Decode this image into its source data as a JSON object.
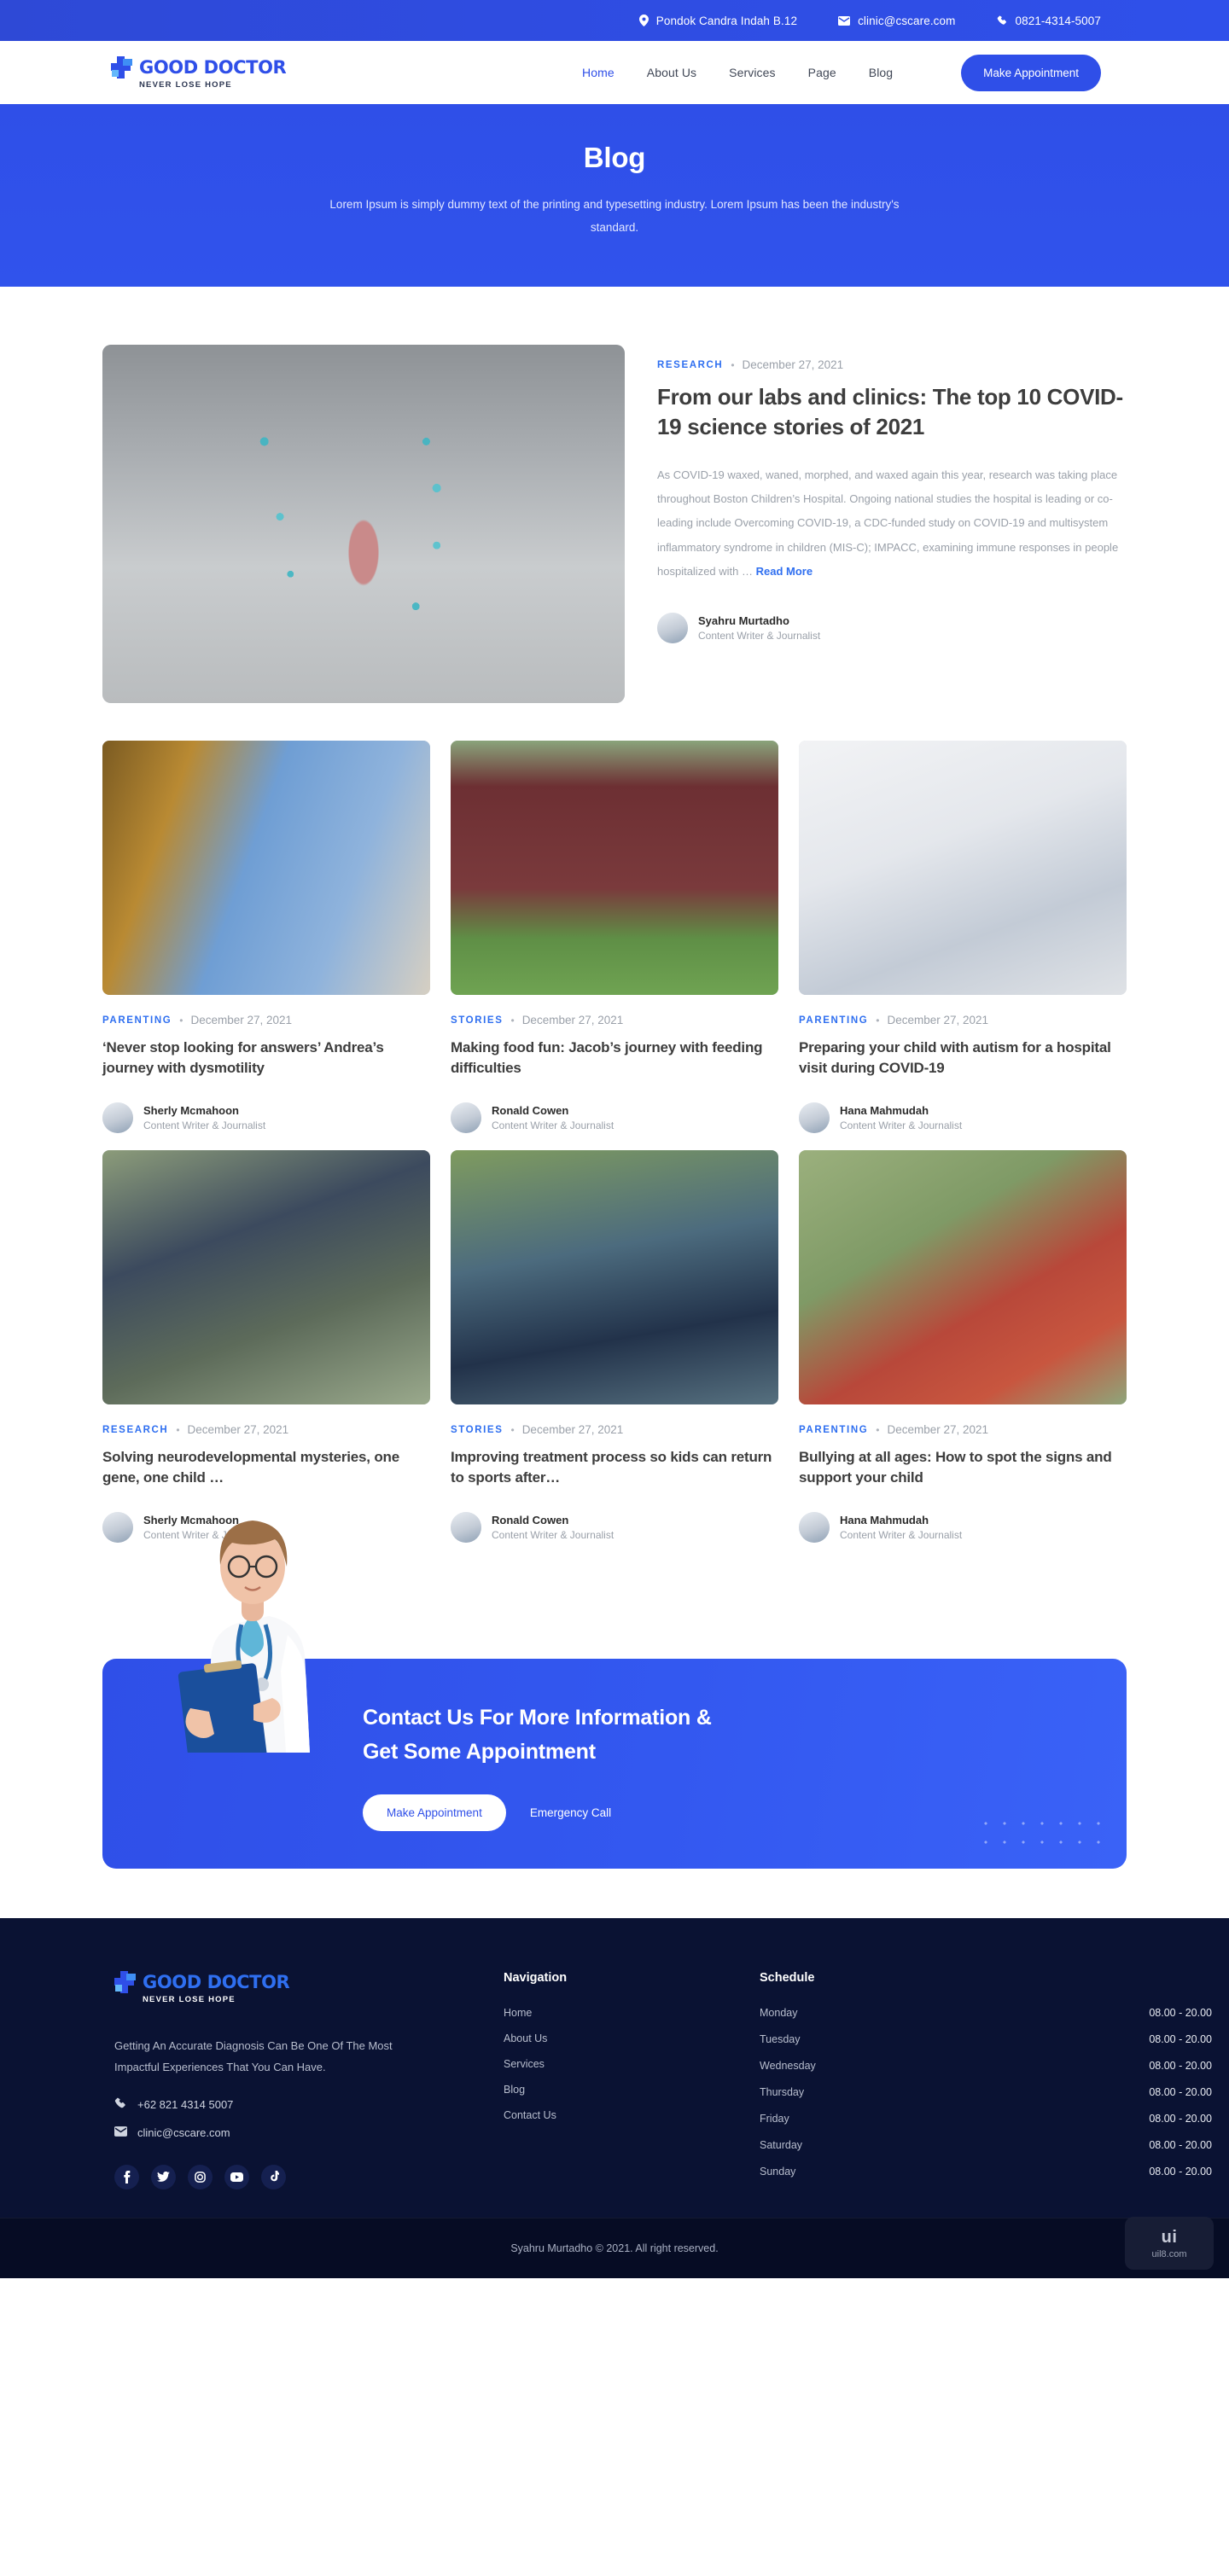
{
  "topbar": {
    "address": "Pondok Candra Indah B.12",
    "email": "clinic@cscare.com",
    "phone": "0821-4314-5007"
  },
  "brand": {
    "name": "GOOD DOCTOR",
    "tagline": "NEVER LOSE HOPE",
    "accent": "#2f4fe8"
  },
  "nav": {
    "items": [
      {
        "label": "Home",
        "active": true
      },
      {
        "label": "About Us",
        "active": false
      },
      {
        "label": "Services",
        "active": false
      },
      {
        "label": "Page",
        "active": false
      },
      {
        "label": "Blog",
        "active": false
      }
    ],
    "cta_label": "Make Appointment"
  },
  "hero": {
    "title": "Blog",
    "subtitle": "Lorem Ipsum is simply dummy text of the printing and typesetting industry. Lorem Ipsum has been the industry's standard."
  },
  "featured": {
    "category": "RESEARCH",
    "separator": "•",
    "date": "December 27, 2021",
    "title": "From our labs and clinics: The top 10 COVID-19 science stories of 2021",
    "excerpt": "As COVID-19 waxed, waned, morphed, and waxed again this year, research was taking place throughout Boston Children’s Hospital. Ongoing national studies the hospital is leading or co-leading include Overcoming COVID-19, a CDC-funded study on COVID-19 and multisystem inflammatory syndrome in children (MIS-C); IMPACC, examining immune responses in people hospitalized with … ",
    "read_more": "Read More",
    "author_name": "Syahru Murtadho",
    "author_role": "Content Writer & Journalist"
  },
  "posts": [
    {
      "category": "PARENTING",
      "date": "December 27, 2021",
      "title": "‘Never stop looking for answers’ Andrea’s journey with dysmotility",
      "author_name": "Sherly Mcmahoon",
      "author_role": "Content Writer & Journalist"
    },
    {
      "category": "STORIES",
      "date": "December 27, 2021",
      "title": "Making food fun: Jacob’s journey with feeding difficulties",
      "author_name": "Ronald Cowen",
      "author_role": "Content Writer & Journalist"
    },
    {
      "category": "PARENTING",
      "date": "December 27, 2021",
      "title": "Preparing your child with autism for a hospital visit during COVID-19",
      "author_name": "Hana Mahmudah",
      "author_role": "Content Writer & Journalist"
    },
    {
      "category": "RESEARCH",
      "date": "December 27, 2021",
      "title": "Solving neurodevelopmental mysteries, one gene, one child …",
      "author_name": "Sherly Mcmahoon",
      "author_role": "Content Writer & Journalist"
    },
    {
      "category": "STORIES",
      "date": "December 27, 2021",
      "title": "Improving treatment process so kids can return to sports after…",
      "author_name": "Ronald Cowen",
      "author_role": "Content Writer & Journalist"
    },
    {
      "category": "PARENTING",
      "date": "December 27, 2021",
      "title": "Bullying at all ages: How to spot the signs and support your child",
      "author_name": "Hana Mahmudah",
      "author_role": "Content Writer & Journalist"
    }
  ],
  "cta": {
    "line1": "Contact Us For More Information &",
    "line2": "Get Some Appointment",
    "primary_label": "Make Appointment",
    "secondary_label": "Emergency Call"
  },
  "footer": {
    "description": "Getting An Accurate Diagnosis Can Be One Of The Most Impactful Experiences That You Can Have.",
    "phone": "+62 821 4314 5007",
    "email": "clinic@cscare.com",
    "socials": [
      "facebook-icon",
      "twitter-icon",
      "instagram-icon",
      "youtube-icon",
      "tiktok-icon"
    ],
    "nav_heading": "Navigation",
    "nav_items": [
      "Home",
      "About Us",
      "Services",
      "Blog",
      "Contact Us"
    ],
    "schedule_heading": "Schedule",
    "schedule": [
      {
        "day": "Monday",
        "hours": "08.00 - 20.00"
      },
      {
        "day": "Tuesday",
        "hours": "08.00 - 20.00"
      },
      {
        "day": "Wednesday",
        "hours": "08.00 - 20.00"
      },
      {
        "day": "Thursday",
        "hours": "08.00 - 20.00"
      },
      {
        "day": "Friday",
        "hours": "08.00 - 20.00"
      },
      {
        "day": "Saturday",
        "hours": "08.00 - 20.00"
      },
      {
        "day": "Sunday",
        "hours": "08.00 - 20.00"
      }
    ],
    "copyright": "Syahru Murtadho © 2021. All right reserved."
  },
  "watermark": {
    "top": "ui",
    "bottom": "uil8.com"
  }
}
